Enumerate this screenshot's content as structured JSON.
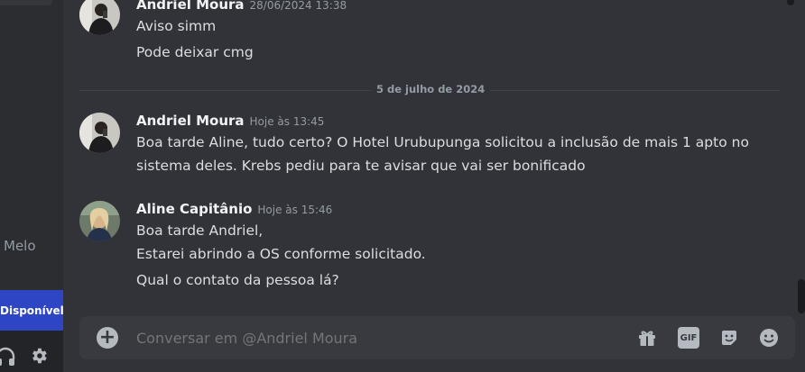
{
  "sidebar": {
    "dm_partial_name": "Melo",
    "status_label": "Disponível"
  },
  "messages": [
    {
      "author": "Andriel Moura",
      "timestamp": "28/06/2024 13:38",
      "lines": [
        "Aviso simm",
        "Pode deixar cmg"
      ]
    },
    {
      "author": "Andriel Moura",
      "timestamp": "Hoje às 13:45",
      "lines": [
        "Boa tarde Aline, tudo certo? O Hotel Urubupunga solicitou a inclusão de mais 1 apto no",
        "sistema deles. Krebs pediu para te avisar que vai ser bonificado"
      ]
    },
    {
      "author": "Aline Capitânio",
      "timestamp": "Hoje às 15:46",
      "lines": [
        "Boa tarde Andriel,",
        "Estarei abrindo a OS conforme solicitado.",
        "Qual o contato da pessoa lá?"
      ]
    }
  ],
  "date_divider": "5 de julho de 2024",
  "composer": {
    "placeholder": "Conversar em @Andriel Moura",
    "gif_label": "GIF"
  },
  "icons": {
    "add": "plus-circle-icon",
    "gift": "gift-icon",
    "gif": "gif-icon",
    "sticker": "sticker-icon",
    "emoji": "emoji-icon",
    "headphones": "headphones-icon",
    "settings": "gear-icon"
  },
  "colors": {
    "background": "#313338",
    "sidebar": "#2b2d31",
    "status_accent": "#2f46c4",
    "composer": "#383a40",
    "muted": "#949ba4"
  }
}
